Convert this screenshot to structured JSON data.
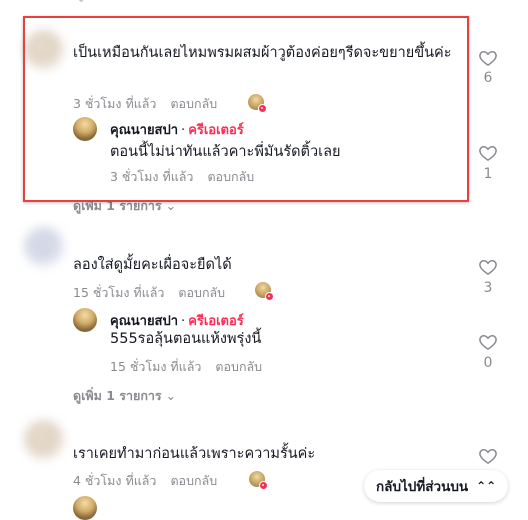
{
  "comments": [
    {
      "text": "เป็นเหมือนกันเลยไหมพรมผสมผ้าวูต้องค่อยๆรีดจะขยายขึ้นค่ะ",
      "time": "3 ชั่วโมง ที่แล้ว",
      "reply_label": "ตอบกลับ",
      "likes": "6",
      "reply": {
        "username": "คุณนายสปา",
        "separator": "·",
        "badge": "ครีเอเตอร์",
        "text": "ตอนนี้ไม่น่าทันแล้วคาะพี่มันรัดติ้วเลย",
        "time": "3 ชั่วโมง ที่แล้ว",
        "reply_label": "ตอบกลับ",
        "likes": "1"
      },
      "more_label": "ดูเพิ่ม 1 รายการ"
    },
    {
      "text": "ลองใส่ดูมั้ยคะเผื่อจะยืดได้",
      "time": "15 ชั่วโมง ที่แล้ว",
      "reply_label": "ตอบกลับ",
      "likes": "3",
      "reply": {
        "username": "คุณนายสปา",
        "separator": "·",
        "badge": "ครีเอเตอร์",
        "text": "555รอลุ้นตอนแห้งพรุ่งนี้",
        "time": "15 ชั่วโมง ที่แล้ว",
        "reply_label": "ตอบกลับ",
        "likes": "0"
      },
      "more_label": "ดูเพิ่ม 1 รายการ"
    },
    {
      "text": "เราเคยทำมาก่อนแล้วเพราะความรั้นค่ะ",
      "time": "4 ชั่วโมง ที่แล้ว",
      "reply_label": "ตอบกลับ"
    }
  ],
  "back_to_top": "กลับไปที่ส่วนบน",
  "back_to_top_icon": "double-chevron-up-icon",
  "colors": {
    "creator_badge": "#fe2c55",
    "highlight_border": "#e84040",
    "meta_text": "#8a8b91"
  }
}
